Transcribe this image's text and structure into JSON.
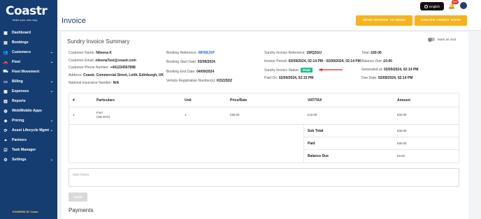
{
  "sidebar": {
    "logo": "Coastr",
    "tagline": "Make your own way",
    "items": [
      {
        "label": "Dashboard",
        "chevron": false
      },
      {
        "label": "Bookings",
        "chevron": false
      },
      {
        "label": "Customers",
        "chevron": true
      },
      {
        "label": "Fleet",
        "chevron": true
      },
      {
        "label": "Fleet Movement",
        "chevron": false
      },
      {
        "label": "Billing",
        "chevron": true
      },
      {
        "label": "Expenses",
        "chevron": true
      },
      {
        "label": "Reports",
        "chevron": false
      },
      {
        "label": "Web/Mobile Apps",
        "chevron": false
      },
      {
        "label": "Pricing",
        "chevron": true
      },
      {
        "label": "Asset Lifecycle Mgmt",
        "chevron": true
      },
      {
        "label": "Partners",
        "chevron": false
      },
      {
        "label": "Task Manager",
        "chevron": false
      },
      {
        "label": "Settings",
        "chevron": true
      }
    ],
    "powered_by": "POWERED BY Coastr"
  },
  "header": {
    "title": "Invoice",
    "language": "English",
    "notification_count": "99+",
    "send_button": "SEND INVOICE TO RENO",
    "credit_button": "CREATE CREDIT NOTE"
  },
  "invoice": {
    "summary_title": "Sundry Invoice Summary",
    "mark_void_label": "Mark as void",
    "col1": {
      "customer_name_label": "Customer Name:",
      "customer_name": "Nileena K",
      "customer_email_label": "Customer Email:",
      "customer_email": "nileenaTest@coastr.com",
      "customer_phone_label": "Customer Phone Number:",
      "customer_phone": "+441234567898",
      "address_label": "Address:",
      "address": "Coastr, Commercial Street, Leith, Edinburgh, UK",
      "ni_label": "National Insurance Number:",
      "ni": "N/A"
    },
    "col2": {
      "booking_ref_label": "Booking Reference:",
      "booking_ref": "WFB8JXP",
      "booking_start_label": "Booking Start Date:",
      "booking_start": "03/09/2024",
      "booking_end_label": "Booking End Date:",
      "booking_end": "04/09/2024",
      "vehicle_reg_label": "Vehicle Registration Number(s):",
      "vehicle_reg": "KD225DZ"
    },
    "col3": {
      "sundry_ref_label": "Sundry Invoice Reference:",
      "sundry_ref": "1WQ2GU",
      "period_label": "Invoice Period:",
      "period": "02/09/2024, 02:14 PM - 02/09/2024, 02:14 PM",
      "status_label": "Sundry Invoice Status:",
      "status": "PAID",
      "paid_on_label": "Paid On:",
      "paid_on": "02/09/2024, 02:15 PM"
    },
    "col4": {
      "total_label": "Total:",
      "total": "£60.00",
      "balance_label": "Balance Due:",
      "balance": "£0.00",
      "generated_label": "Generated at:",
      "generated": "02/09/2024, 02:14 PM",
      "due_label": "Due Date:",
      "due": "02/09/2024, 02:14 PM"
    },
    "status_color": "#1fbf8a"
  },
  "table": {
    "headers": [
      "#",
      "Particulars",
      "Unit",
      "Price/Rate",
      "VAT/TAX",
      "Amount"
    ],
    "rows": [
      {
        "index": "1",
        "particular": "Fuel",
        "particular_sub": "(Vat 20%)",
        "unit": "1",
        "price": "£50.00",
        "vat": "£10.00",
        "amount": "£60.00"
      }
    ],
    "totals": [
      {
        "label": "Sub Total",
        "value": "£60.00"
      },
      {
        "label": "Paid",
        "value": "£60.00"
      },
      {
        "label": "Balance Due",
        "value": "£0.00"
      }
    ]
  },
  "notes": {
    "placeholder": "Add Notes"
  },
  "save_button": "SAVE",
  "payments_title": "Payments",
  "colors": {
    "sidebar": "#153d72",
    "accent": "#f7b21c",
    "badge": "#e53935"
  }
}
